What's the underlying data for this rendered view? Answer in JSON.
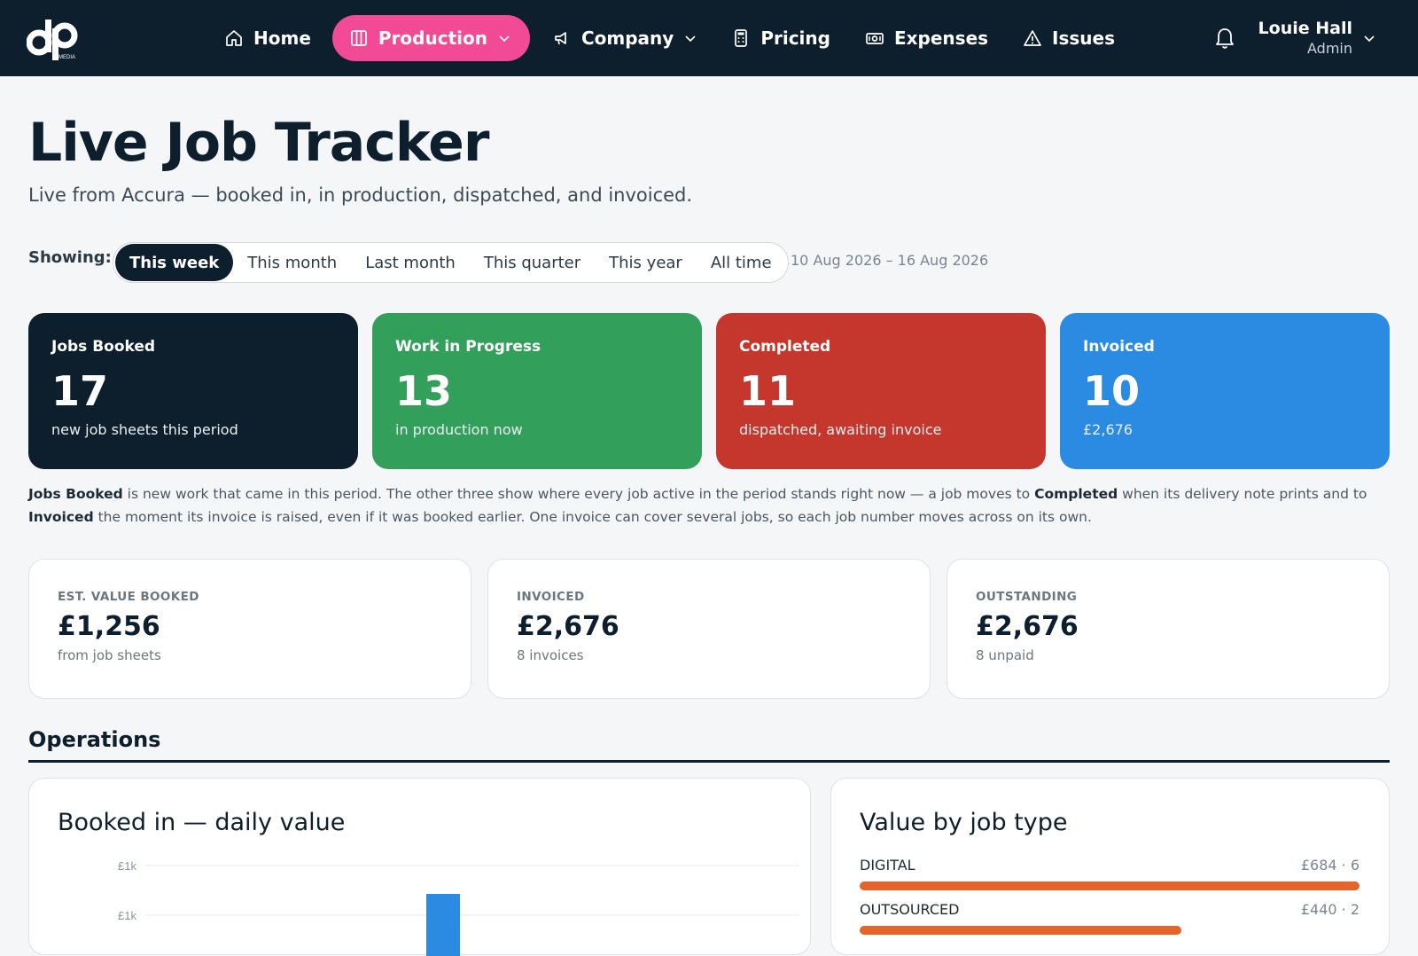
{
  "nav": {
    "logo_text": "MEDIA",
    "items": [
      {
        "label": "Home",
        "icon": "home-icon",
        "active": false,
        "dropdown": false
      },
      {
        "label": "Production",
        "icon": "production-icon",
        "active": true,
        "dropdown": true
      },
      {
        "label": "Company",
        "icon": "megaphone-icon",
        "active": false,
        "dropdown": true
      },
      {
        "label": "Pricing",
        "icon": "calculator-icon",
        "active": false,
        "dropdown": false
      },
      {
        "label": "Expenses",
        "icon": "banknote-icon",
        "active": false,
        "dropdown": false
      },
      {
        "label": "Issues",
        "icon": "warning-icon",
        "active": false,
        "dropdown": false
      }
    ],
    "user": {
      "name": "Louie Hall",
      "role": "Admin"
    }
  },
  "header": {
    "title": "Live Job Tracker",
    "subtitle": "Live from Accura — booked in, in production, dispatched, and invoiced."
  },
  "filter": {
    "label": "Showing:",
    "options": [
      "This week",
      "This month",
      "Last month",
      "This quarter",
      "This year",
      "All time"
    ],
    "selected": "This week",
    "range": "10 Aug 2026 – 16 Aug 2026"
  },
  "stats": [
    {
      "label": "Jobs Booked",
      "value": "17",
      "sub": "new job sheets this period",
      "color": "#0d1e2c"
    },
    {
      "label": "Work in Progress",
      "value": "13",
      "sub": "in production now",
      "color": "#32a05a"
    },
    {
      "label": "Completed",
      "value": "11",
      "sub": "dispatched, awaiting invoice",
      "color": "#c5362c"
    },
    {
      "label": "Invoiced",
      "value": "10",
      "sub": "£2,676",
      "color": "#2b8be3"
    }
  ],
  "explanation": {
    "b1": "Jobs Booked",
    "t1": " is new work that came in this period. The other three show where every job active in the period stands right now — a job moves to ",
    "b2": "Completed",
    "t2": " when its delivery note prints and to ",
    "b3": "Invoiced",
    "t3": " the moment its invoice is raised, even if it was booked earlier. One invoice can cover several jobs, so each job number moves across on its own."
  },
  "values": [
    {
      "label": "EST. VALUE BOOKED",
      "value": "£1,256",
      "sub": "from job sheets"
    },
    {
      "label": "INVOICED",
      "value": "£2,676",
      "sub": "8 invoices"
    },
    {
      "label": "OUTSTANDING",
      "value": "£2,676",
      "sub": "8 unpaid"
    }
  ],
  "operations": {
    "title": "Operations",
    "daily_panel": {
      "title": "Booked in — daily value"
    },
    "jobtype_panel": {
      "title": "Value by job type",
      "rows": [
        {
          "name": "DIGITAL",
          "value": "£684 · 6",
          "amount": 684
        },
        {
          "name": "OUTSOURCED",
          "value": "£440 · 2",
          "amount": 440
        }
      ]
    }
  },
  "chart_data": {
    "type": "bar",
    "title": "Booked in — daily value",
    "y_ticks": [
      "£1k",
      "£1k"
    ],
    "ylim": [
      0,
      1000
    ],
    "categories": [],
    "values": [],
    "color": "#2b8be3"
  },
  "colors": {
    "accent": "#f24a94",
    "nav_bg": "#0d1e2c",
    "bar_orange": "#e4652c",
    "bar_blue": "#2b8be3"
  }
}
